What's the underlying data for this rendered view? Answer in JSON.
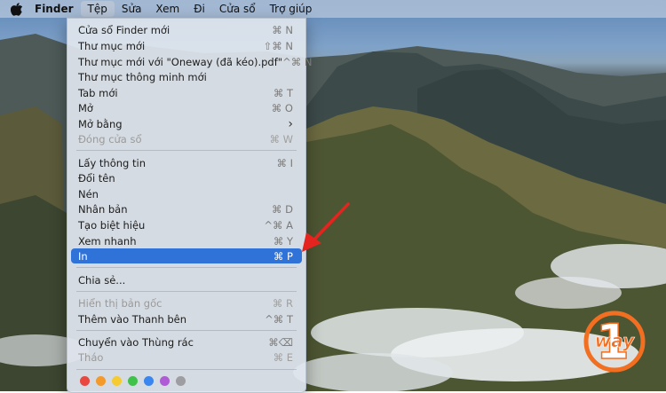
{
  "menubar": {
    "apple_icon": "apple-logo-icon",
    "items": [
      "Finder",
      "Tệp",
      "Sửa",
      "Xem",
      "Đi",
      "Cửa sổ",
      "Trợ giúp"
    ]
  },
  "menu": {
    "items": [
      {
        "label": "Cửa sổ Finder mới",
        "shortcut": "⌘ N"
      },
      {
        "label": "Thư mục mới",
        "shortcut": "⇧⌘ N"
      },
      {
        "label": "Thư mục mới với \"Oneway (đã kéo).pdf\"",
        "shortcut": "^⌘ N"
      },
      {
        "label": "Thư mục thông minh mới",
        "shortcut": ""
      },
      {
        "label": "Tab mới",
        "shortcut": "⌘ T"
      },
      {
        "label": "Mở",
        "shortcut": "⌘ O"
      },
      {
        "label": "Mở bằng",
        "shortcut": "›"
      },
      {
        "label": "Đóng cửa sổ",
        "shortcut": "⌘ W"
      },
      {
        "label": "Lấy thông tin",
        "shortcut": "⌘ I"
      },
      {
        "label": "Đổi tên",
        "shortcut": ""
      },
      {
        "label": "Nén",
        "shortcut": ""
      },
      {
        "label": "Nhân bản",
        "shortcut": "⌘ D"
      },
      {
        "label": "Tạo biệt hiệu",
        "shortcut": "^⌘ A"
      },
      {
        "label": "Xem nhanh",
        "shortcut": "⌘ Y"
      },
      {
        "label": "In",
        "shortcut": "⌘ P"
      },
      {
        "label": "Chia sẻ...",
        "shortcut": ""
      },
      {
        "label": "Hiển thị bản gốc",
        "shortcut": "⌘ R"
      },
      {
        "label": "Thêm vào Thanh bên",
        "shortcut": "^⌘ T"
      },
      {
        "label": "Chuyển vào Thùng rác",
        "shortcut": "⌘⌫"
      },
      {
        "label": "Tháo",
        "shortcut": "⌘ E"
      }
    ],
    "tag_colors": [
      "#e8483f",
      "#f39a2b",
      "#f5cb2f",
      "#3fc24a",
      "#3a86f0",
      "#b05bd6",
      "#9d9da2"
    ]
  },
  "annotation": {
    "arrow_color": "#e52420"
  },
  "watermark": {
    "text": "way",
    "digit": "1",
    "brand_color": "#f26f21"
  }
}
